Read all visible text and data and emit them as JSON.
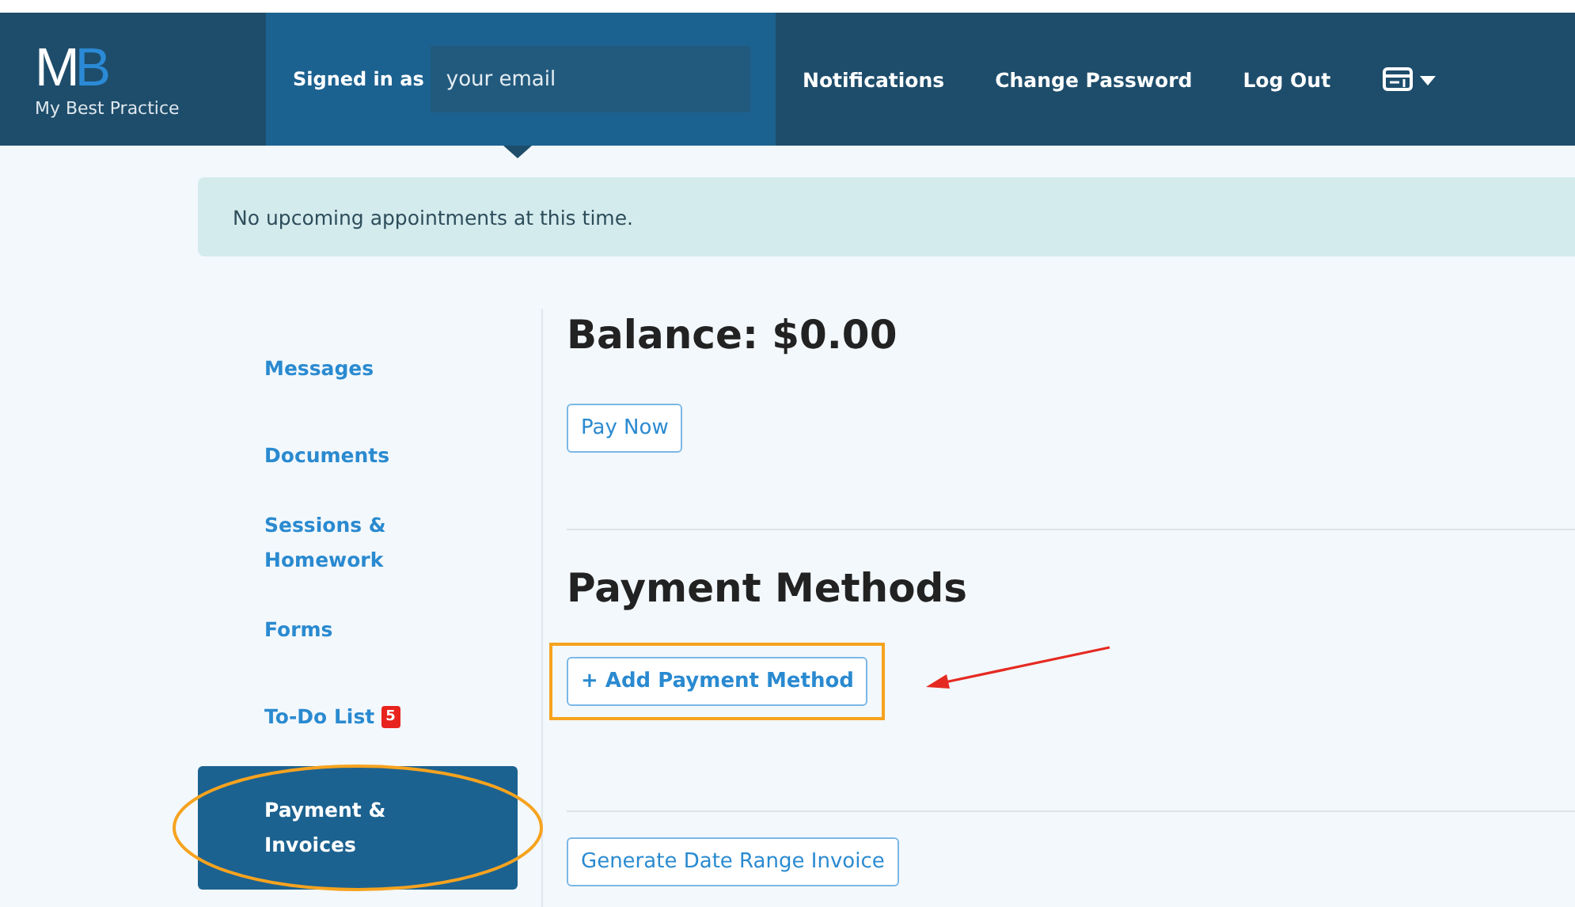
{
  "header": {
    "logo": {
      "letters": [
        {
          "text": "M",
          "accent": false
        },
        {
          "text": "B",
          "accent": true
        }
      ],
      "name": "My Best Practice"
    },
    "signed_in": {
      "label": "Signed in as",
      "placeholder": "your email"
    },
    "nav": [
      "Notifications",
      "Change Password",
      "Log Out"
    ]
  },
  "alert": "No upcoming appointments at this time.",
  "sidebar": {
    "items": [
      {
        "label": "Messages",
        "selected": false,
        "highlighted": false
      },
      {
        "label": "Documents",
        "selected": false,
        "highlighted": false
      },
      {
        "label": "Sessions & Homework",
        "selected": false,
        "highlighted": false
      },
      {
        "label": "Forms",
        "selected": false,
        "highlighted": false
      },
      {
        "label": "To-Do List",
        "badge": "5",
        "selected": false,
        "highlighted": false
      },
      {
        "label": "Payment & Invoices",
        "selected": true,
        "highlighted": true
      }
    ]
  },
  "content": {
    "sections": [
      {
        "heading": "Balance: $0.00",
        "button": {
          "label": "Pay Now",
          "bold": false,
          "highlighted": false
        }
      },
      {
        "heading": "Payment Methods",
        "button": {
          "label": "+ Add Payment Method",
          "bold": true,
          "highlighted": true
        }
      },
      {
        "button": {
          "label": "Generate Date Range Invoice",
          "bold": false,
          "highlighted": false
        }
      }
    ]
  }
}
